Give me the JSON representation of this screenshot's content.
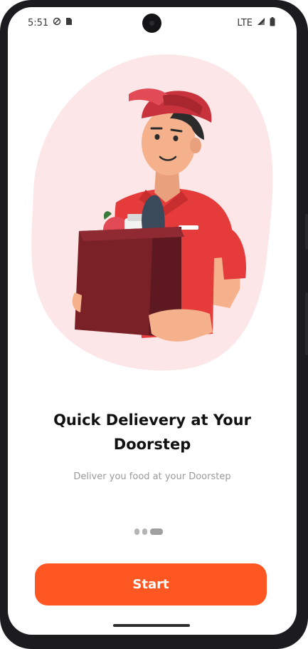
{
  "status_bar": {
    "time": "5:51",
    "network": "LTE",
    "icons": [
      "data-saver-icon",
      "sim-card-icon",
      "signal-icon",
      "battery-icon"
    ]
  },
  "onboarding": {
    "title": "Quick Delievery at Your Doorstep",
    "subtitle": "Deliver you food at your Doorstep",
    "illustration": "delivery-man-with-grocery-bag",
    "pages": {
      "total": 3,
      "current": 3
    }
  },
  "actions": {
    "start_label": "Start"
  },
  "colors": {
    "accent": "#FF5722",
    "blob": "#FDE6E7",
    "shirt": "#E53B3B",
    "bag": "#7A2128"
  }
}
